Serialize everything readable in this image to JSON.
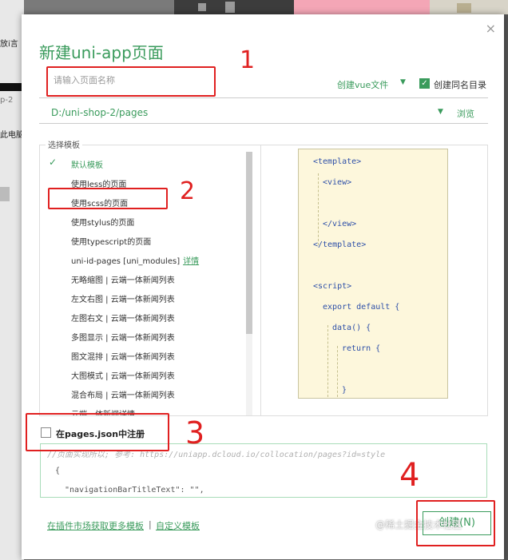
{
  "background": {
    "left_fragments": [
      "放i言",
      "p-2",
      "此电脑"
    ]
  },
  "dialog": {
    "title": "新建uni-app页面",
    "close_label": "×",
    "name_placeholder": "请输入页面名称",
    "vue_file_select": "创建vue文件",
    "same_dir_checkbox_label": "创建同名目录",
    "same_dir_checked": true,
    "path": "D:/uni-shop-2/pages",
    "browse_label": "浏览",
    "template_legend": "选择模板",
    "templates": [
      {
        "label": "默认模板",
        "selected": true,
        "link": ""
      },
      {
        "label": "使用less的页面",
        "selected": false,
        "link": ""
      },
      {
        "label": "使用scss的页面",
        "selected": false,
        "link": ""
      },
      {
        "label": "使用stylus的页面",
        "selected": false,
        "link": ""
      },
      {
        "label": "使用typescript的页面",
        "selected": false,
        "link": ""
      },
      {
        "label": "uni-id-pages [uni_modules]",
        "selected": false,
        "link": "详情"
      },
      {
        "label": "无略缩图 | 云端一体新闻列表",
        "selected": false,
        "link": ""
      },
      {
        "label": "左文右图 | 云端一体新闻列表",
        "selected": false,
        "link": ""
      },
      {
        "label": "左图右文 | 云端一体新闻列表",
        "selected": false,
        "link": ""
      },
      {
        "label": "多图显示 | 云端一体新闻列表",
        "selected": false,
        "link": ""
      },
      {
        "label": "图文混排 | 云端一体新闻列表",
        "selected": false,
        "link": ""
      },
      {
        "label": "大图模式 | 云端一体新闻列表",
        "selected": false,
        "link": ""
      },
      {
        "label": "混合布局 | 云端一体新闻列表",
        "selected": false,
        "link": ""
      },
      {
        "label": "云端一体新闻详情",
        "selected": false,
        "link": ""
      }
    ],
    "preview_code": [
      "<template>",
      "<view>",
      "</view>",
      "</template>",
      "<script>",
      "export default {",
      "data() {",
      "return {",
      "}"
    ],
    "register_label": "在pages.json中注册",
    "register_checked": false,
    "json_preview": [
      "//页面实现所以; 参考: https://uniapp.dcloud.io/collocation/pages?id=style",
      "{",
      "\"navigationBarTitleText\": \"\","
    ],
    "footer_link_market": "在插件市场获取更多模板",
    "footer_separator": "|",
    "footer_link_custom": "自定义模板",
    "create_button": "创建(N)",
    "watermark": "@稀土掘金技术社区"
  },
  "annotations": {
    "marks": [
      "1",
      "2",
      "3",
      "4"
    ],
    "color": "#e02020"
  },
  "colors": {
    "accent": "#3a9b5c",
    "code": "#2d4fa8",
    "preview_bg": "#fdf7dc"
  }
}
